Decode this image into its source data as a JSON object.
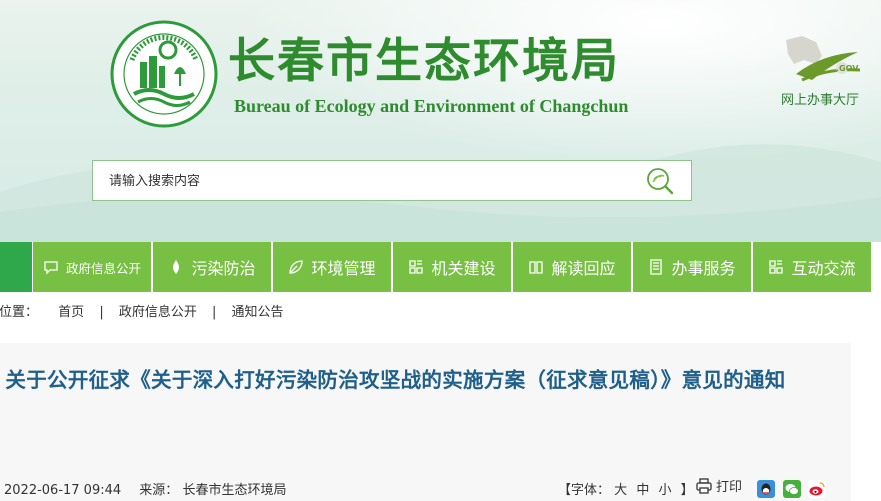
{
  "header": {
    "title": "长春市生态环境局",
    "subtitle": "Bureau of Ecology and Environment of Changchun",
    "gov_hall_label": "网上办事大厅",
    "colors": {
      "brand_green": "#2e8b2e",
      "nav_green": "#78c044",
      "title_blue": "#1f5f8b"
    }
  },
  "search": {
    "placeholder": "请输入搜索内容",
    "icon": "magnifier-leaf-icon"
  },
  "nav": {
    "items": [
      {
        "label": "政府信息公开",
        "icon": "chat-bubble-icon"
      },
      {
        "label": "污染防治",
        "icon": "leaf-drop-icon"
      },
      {
        "label": "环境管理",
        "icon": "leaf-icon"
      },
      {
        "label": "机关建设",
        "icon": "grid-icon"
      },
      {
        "label": "解读回应",
        "icon": "book-icon"
      },
      {
        "label": "办事服务",
        "icon": "document-icon"
      },
      {
        "label": "互动交流",
        "icon": "grid-icon"
      }
    ]
  },
  "breadcrumb": {
    "label": "的位置：",
    "items": [
      "首页",
      "政府信息公开",
      "通知公告"
    ],
    "separator": "|"
  },
  "article": {
    "title": "关于公开征求《关于深入打好污染防治攻坚战的实施方案（征求意见稿）》意见的通知",
    "date": "2022-06-17 09:44",
    "source_label": "来源：",
    "source": "长春市生态环境局",
    "font_label": "【字体：",
    "font_options": [
      "大",
      "中",
      "小"
    ],
    "font_close": "】",
    "print_label": "打印",
    "share_icons": [
      "qq-icon",
      "wechat-icon",
      "weibo-icon"
    ]
  }
}
